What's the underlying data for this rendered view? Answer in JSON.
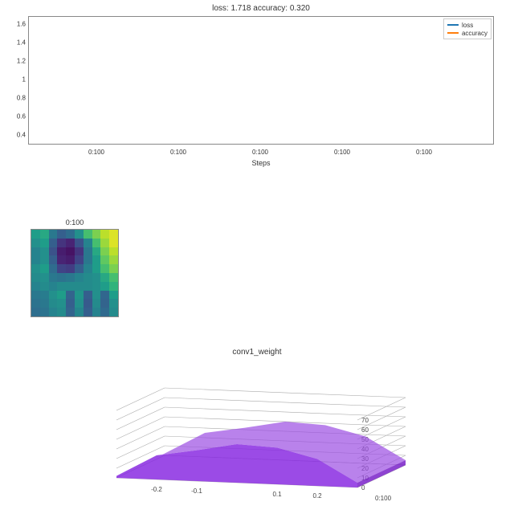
{
  "chart_data": [
    {
      "type": "line",
      "title": "loss: 1.718   accuracy: 0.320",
      "xlabel": "Steps",
      "ylabel": "",
      "ylim": [
        0.3,
        1.7
      ],
      "y_ticks": [
        0.4,
        0.6,
        0.8,
        1.0,
        1.2,
        1.4,
        1.6
      ],
      "x_ticks": [
        "0:100",
        "0:100",
        "0:100",
        "0:100",
        "0:100"
      ],
      "series": [
        {
          "name": "loss",
          "color": "#1f77b4",
          "values": []
        },
        {
          "name": "accuracy",
          "color": "#ff7f0e",
          "values": []
        }
      ],
      "legend_position": "upper right"
    },
    {
      "type": "heatmap",
      "title": "0:100",
      "grid": [
        [
          0.55,
          0.6,
          0.4,
          0.3,
          0.35,
          0.5,
          0.7,
          0.8,
          0.9,
          0.95
        ],
        [
          0.5,
          0.55,
          0.3,
          0.15,
          0.1,
          0.25,
          0.45,
          0.7,
          0.85,
          0.95
        ],
        [
          0.45,
          0.5,
          0.25,
          0.08,
          0.05,
          0.15,
          0.4,
          0.6,
          0.8,
          0.9
        ],
        [
          0.45,
          0.5,
          0.3,
          0.1,
          0.08,
          0.2,
          0.4,
          0.55,
          0.75,
          0.85
        ],
        [
          0.5,
          0.55,
          0.35,
          0.2,
          0.18,
          0.3,
          0.45,
          0.55,
          0.7,
          0.8
        ],
        [
          0.48,
          0.5,
          0.4,
          0.38,
          0.4,
          0.45,
          0.48,
          0.5,
          0.6,
          0.7
        ],
        [
          0.45,
          0.48,
          0.45,
          0.48,
          0.48,
          0.48,
          0.48,
          0.5,
          0.55,
          0.65
        ],
        [
          0.4,
          0.42,
          0.5,
          0.55,
          0.32,
          0.52,
          0.3,
          0.5,
          0.33,
          0.55
        ],
        [
          0.38,
          0.4,
          0.48,
          0.5,
          0.3,
          0.5,
          0.28,
          0.48,
          0.32,
          0.5
        ],
        [
          0.36,
          0.38,
          0.45,
          0.48,
          0.32,
          0.46,
          0.3,
          0.45,
          0.34,
          0.48
        ]
      ],
      "colormap": "viridis"
    },
    {
      "type": "area",
      "subtype": "3d_histogram",
      "title": "conv1_weight",
      "x": [
        -0.3,
        -0.2,
        -0.1,
        0.0,
        0.1,
        0.2,
        0.3
      ],
      "values": [
        2,
        25,
        32,
        40,
        38,
        28,
        5
      ],
      "x_ticks": [
        -0.2,
        -0.1,
        0.1,
        0.2
      ],
      "z_ticks": [
        0,
        10,
        20,
        30,
        40,
        50,
        60,
        70
      ],
      "y_tick_label": "0:100",
      "color": "#8a2be2"
    }
  ],
  "top": {
    "title": "loss: 1.718   accuracy: 0.320",
    "xlabel": "Steps",
    "legend": {
      "loss": "loss",
      "accuracy": "accuracy"
    }
  },
  "heatmap": {
    "title": "0:100"
  },
  "hist3d": {
    "title": "conv1_weight",
    "ytick": "0:100"
  }
}
